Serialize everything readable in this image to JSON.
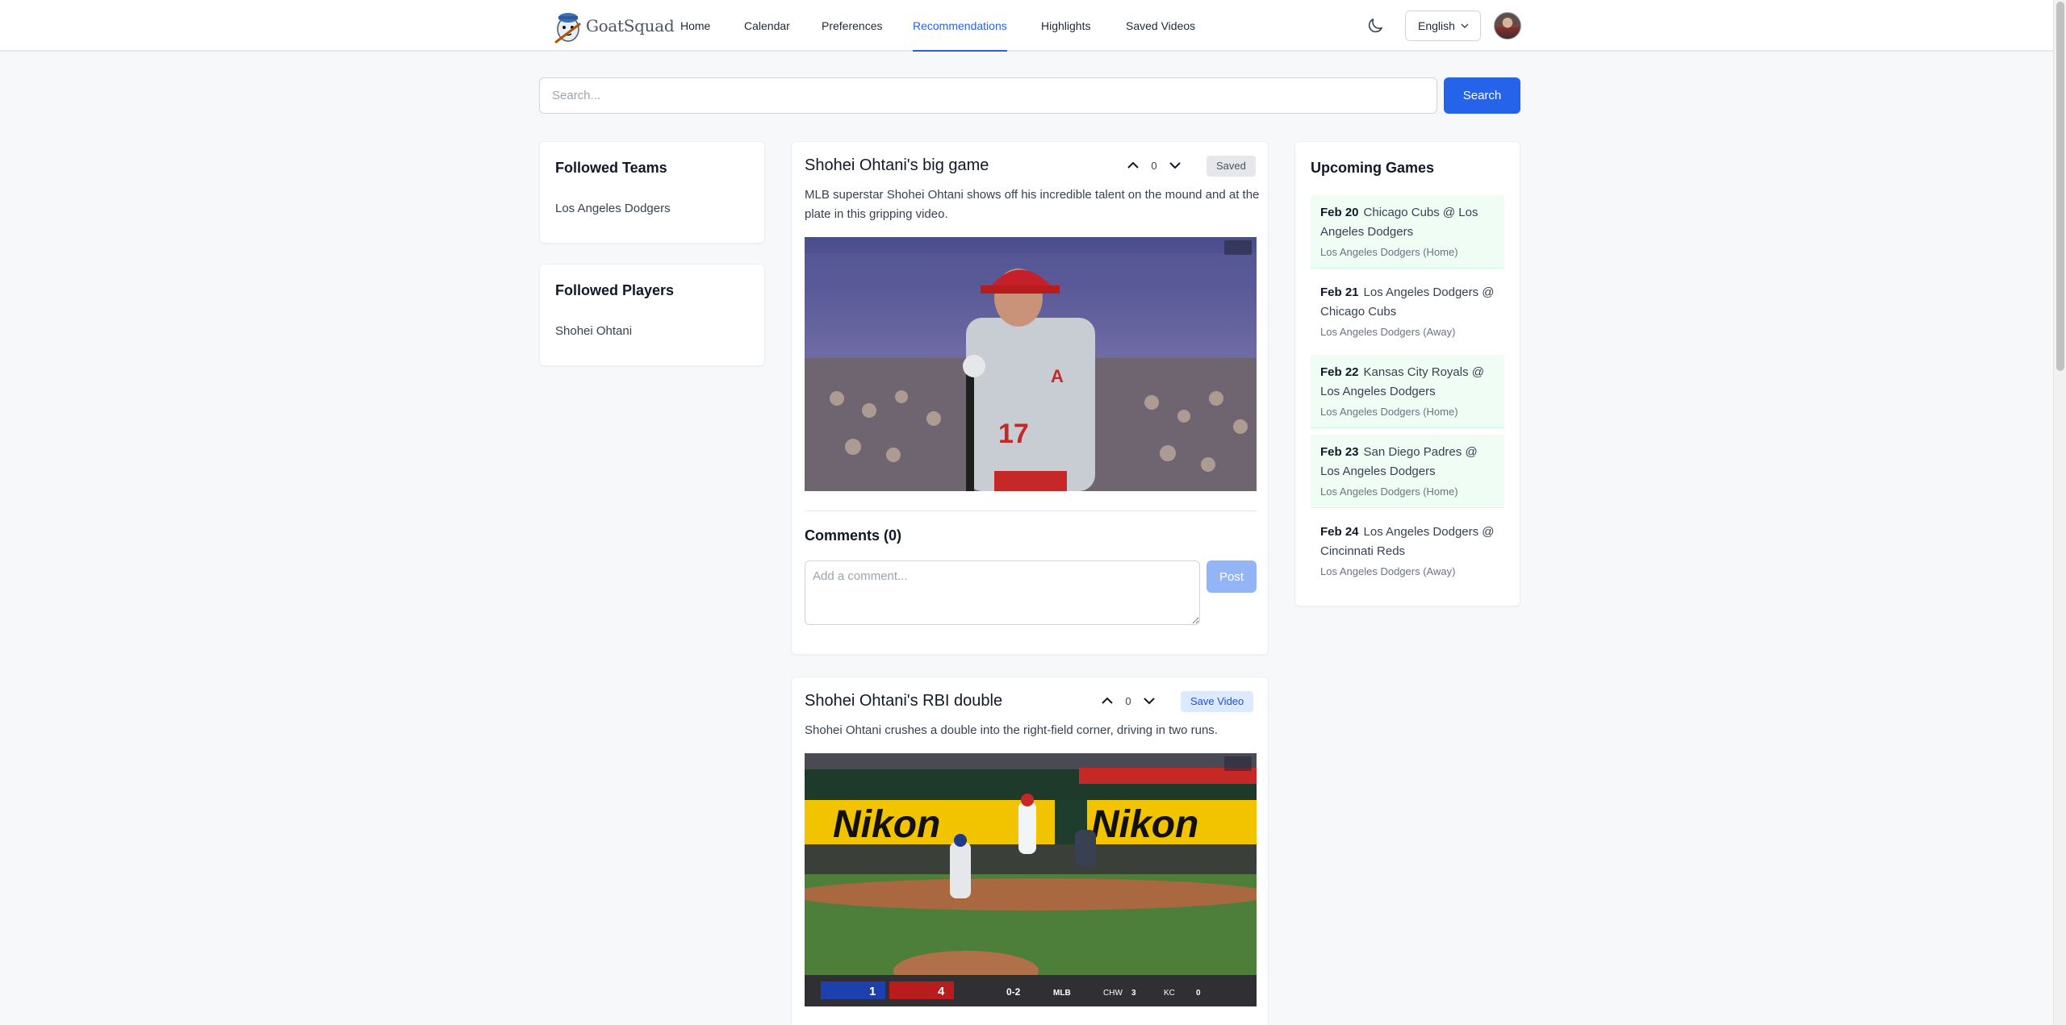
{
  "nav": {
    "brand": "GoatSquad",
    "links": [
      "Home",
      "Calendar",
      "Preferences",
      "Recommendations",
      "Highlights",
      "Saved Videos"
    ],
    "active": "Recommendations",
    "language": "English"
  },
  "search": {
    "placeholder": "Search...",
    "button": "Search"
  },
  "sidebar": {
    "teams_title": "Followed Teams",
    "teams": [
      "Los Angeles Dodgers"
    ],
    "players_title": "Followed Players",
    "players": [
      "Shohei Ohtani"
    ]
  },
  "videos": [
    {
      "title": "Shohei Ohtani's big game",
      "votes": "0",
      "save_label": "Saved",
      "description": "MLB superstar Shohei Ohtani shows off his incredible talent on the mound and at the plate in this gripping video.",
      "comments_title": "Comments (0)",
      "comment_placeholder": "Add a comment...",
      "post_label": "Post"
    },
    {
      "title": "Shohei Ohtani's RBI double",
      "votes": "0",
      "save_label": "Save Video",
      "description": "Shohei Ohtani crushes a double into the right-field corner, driving in two runs."
    }
  ],
  "upcoming": {
    "title": "Upcoming Games",
    "games": [
      {
        "date": "Feb 20",
        "matchup": "Chicago Cubs @ Los Angeles Dodgers",
        "meta": "Los Angeles Dodgers (Home)"
      },
      {
        "date": "Feb 21",
        "matchup": "Los Angeles Dodgers @ Chicago Cubs",
        "meta": "Los Angeles Dodgers (Away)"
      },
      {
        "date": "Feb 22",
        "matchup": "Kansas City Royals @ Los Angeles Dodgers",
        "meta": "Los Angeles Dodgers (Home)"
      },
      {
        "date": "Feb 23",
        "matchup": "San Diego Padres @ Los Angeles Dodgers",
        "meta": "Los Angeles Dodgers (Home)"
      },
      {
        "date": "Feb 24",
        "matchup": "Los Angeles Dodgers @ Cincinnati Reds",
        "meta": "Los Angeles Dodgers (Away)"
      }
    ]
  },
  "scoreboard": {
    "away_score": "1",
    "home_score": "4",
    "count": "0-2",
    "league": "MLB",
    "ticker": [
      "CHW",
      "3",
      "KC",
      "0"
    ]
  },
  "colors": {
    "accent": "#2563eb",
    "home_game_bg": "#f0fdf4"
  }
}
